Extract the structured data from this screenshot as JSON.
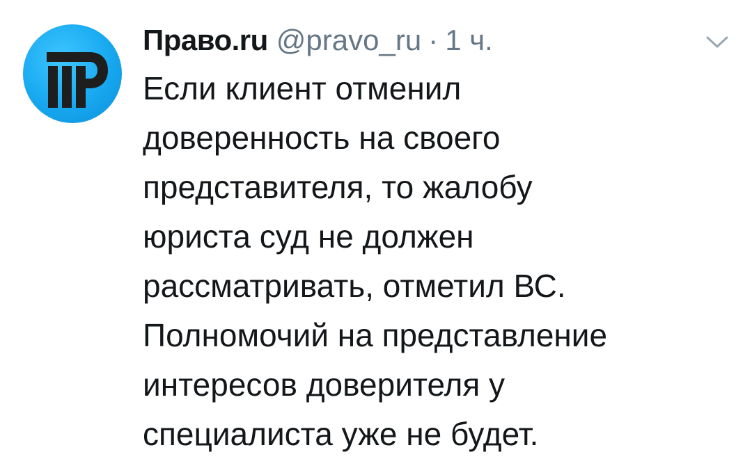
{
  "tweet": {
    "avatar_icon": "pravo-ru-logo-icon",
    "author_name": "Право.ru",
    "handle": "@pravo_ru",
    "separator": "·",
    "time": "1 ч.",
    "menu_icon": "chevron-down-icon",
    "text": "Если клиент отменил\nдоверенность на своего\nпредставителя, то жалобу\nюриста суд не должен\nрассматривать, отметил ВС.\nПолномочий на представление\nинтересов доверителя у\nспециалиста уже не будет."
  },
  "colors": {
    "text_primary": "#14171a",
    "text_secondary": "#657786",
    "avatar_blue": "#17a8f0",
    "logo_dark": "#1e1e1e"
  }
}
